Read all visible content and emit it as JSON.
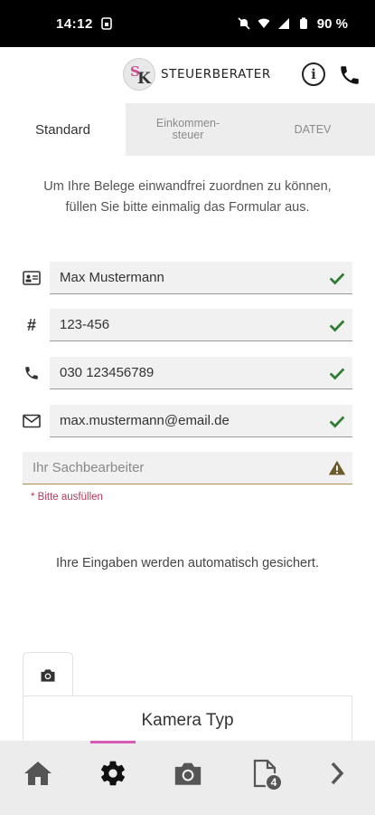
{
  "status_bar": {
    "time": "14:12",
    "battery": "90 %",
    "icons": [
      "sim-icon",
      "mute-icon",
      "wifi-icon",
      "signal-icon",
      "battery-icon"
    ]
  },
  "header": {
    "logo_text": "STEUERBERATER",
    "info_icon": "info-icon",
    "phone_icon": "phone-icon"
  },
  "tabs": [
    {
      "label": "Standard",
      "active": true
    },
    {
      "label_line1": "Einkommen-",
      "label_line2": "steuer",
      "active": false
    },
    {
      "label": "DATEV",
      "active": false
    }
  ],
  "intro": {
    "line1": "Um Ihre Belege einwandfrei zuordnen zu können,",
    "line2": "füllen Sie bitte einmalig das Formular aus."
  },
  "form": {
    "name": {
      "icon": "id-card-icon",
      "value": "Max Mustermann",
      "status": "valid"
    },
    "number": {
      "icon": "hash-icon",
      "value": "123-456",
      "status": "valid"
    },
    "phone": {
      "icon": "phone-icon",
      "value": "030 123456789",
      "status": "valid"
    },
    "email": {
      "icon": "mail-icon",
      "value": "max.mustermann@email.de",
      "status": "valid"
    },
    "clerk": {
      "placeholder": "Ihr Sachbearbeiter",
      "status": "warning"
    },
    "hint": "* Bitte ausfüllen"
  },
  "saved_note": "Ihre Eingaben werden automatisch gesichert.",
  "camera": {
    "tab_icon": "camera-icon",
    "title": "Kamera Typ"
  },
  "bottom_nav": {
    "items": [
      "home-icon",
      "gear-icon",
      "camera-icon",
      "document-icon",
      "chevron-right-icon"
    ],
    "active_index": 1,
    "document_badge": "4"
  },
  "colors": {
    "accent": "#d65ab6",
    "check_green": "#2e7d32",
    "warning": "#6b5a2a",
    "hint_red": "#b3385a"
  }
}
